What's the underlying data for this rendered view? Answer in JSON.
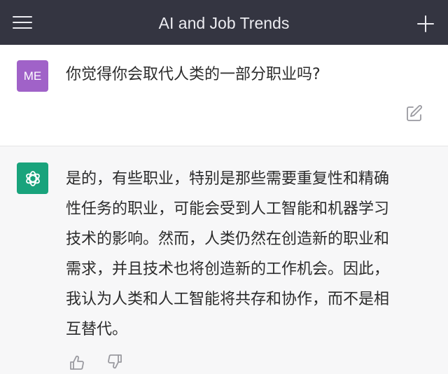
{
  "header": {
    "title": "AI and Job Trends",
    "menu_icon": "hamburger-menu-icon",
    "new_chat_icon": "plus-icon"
  },
  "user_message": {
    "avatar_initials": "ME",
    "avatar_color": "#a062c8",
    "text": "你觉得你会取代人类的一部分职业吗?",
    "edit_icon": "edit-icon"
  },
  "assistant_message": {
    "avatar_icon": "openai-logo-icon",
    "avatar_color": "#19a37c",
    "lines": [
      "是的，有些职业，特别是那些需要重复性和精确",
      "性任务的职业，可能会受到人工智能和机器学习",
      "技术的影响。然而，人类仍然在创造新的职业和",
      "需求，并且技术也将创造新的工作机会。因此，",
      "我认为人类和人工智能将共存和协作，而不是相",
      "互替代。"
    ],
    "feedback_icons": [
      "thumbs-up-icon",
      "thumbs-down-icon"
    ]
  },
  "colors": {
    "topbar": "#343541",
    "user_bg": "#ffffff",
    "assistant_bg": "#f7f7f8"
  }
}
